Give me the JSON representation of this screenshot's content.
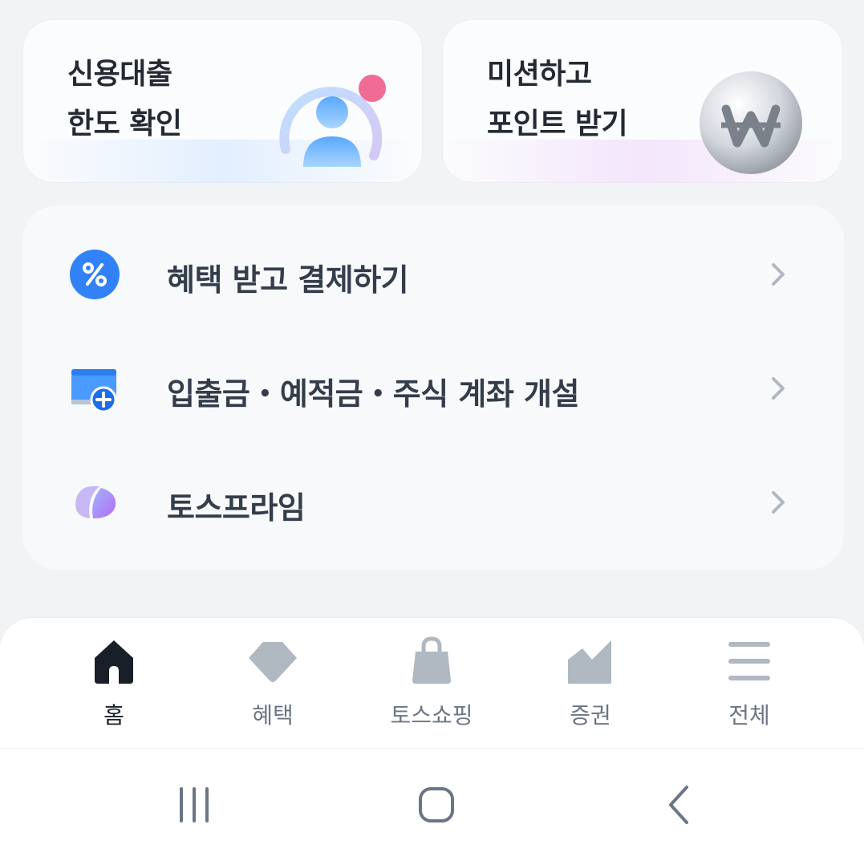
{
  "promos": [
    {
      "line1": "신용대출",
      "line2": "한도 확인",
      "icon": "credit-limit-user-icon"
    },
    {
      "line1": "미션하고",
      "line2": "포인트 받기",
      "icon": "won-coin-icon"
    }
  ],
  "menu": [
    {
      "label": "혜택 받고 결제하기",
      "icon": "percent-icon"
    },
    {
      "label": "입출금・예적금・주식 계좌 개설",
      "icon": "account-open-icon"
    },
    {
      "label": "토스프라임",
      "icon": "toss-prime-icon"
    }
  ],
  "tabs": [
    {
      "label": "홈",
      "icon": "home-icon",
      "active": true
    },
    {
      "label": "혜택",
      "icon": "diamond-icon",
      "active": false
    },
    {
      "label": "토스쇼핑",
      "icon": "shopping-bag-icon",
      "active": false
    },
    {
      "label": "증권",
      "icon": "stock-chart-icon",
      "active": false
    },
    {
      "label": "전체",
      "icon": "menu-icon",
      "active": false
    }
  ],
  "system_nav": [
    "recent-apps-icon",
    "home-button-icon",
    "back-icon"
  ],
  "colors": {
    "accent_blue": "#3182f6",
    "tab_inactive": "#b0b8c1",
    "tab_active": "#191f28",
    "text": "#333d4b"
  }
}
